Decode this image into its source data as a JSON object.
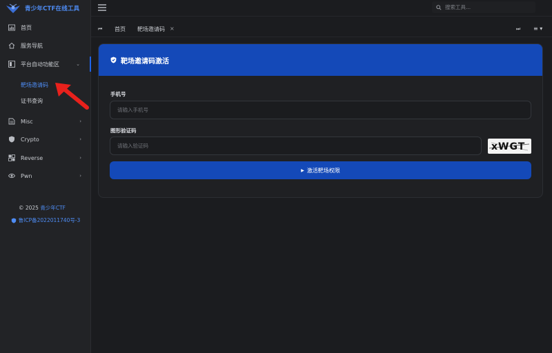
{
  "app": {
    "logo_text": "青少年CTF在线工具",
    "copyright_prefix": "© 2025",
    "copyright_brand": "青少年CTF",
    "icp": "鲁ICP备2022011740号-3"
  },
  "header": {
    "search_placeholder": "搜索工具..."
  },
  "sidebar": {
    "items": [
      {
        "label": "首页",
        "icon": "chart-icon"
      },
      {
        "label": "服务导航",
        "icon": "home-icon"
      },
      {
        "label": "平台自动功能区",
        "icon": "grid-icon",
        "expanded": true
      },
      {
        "label": "Misc",
        "icon": "file-icon"
      },
      {
        "label": "Crypto",
        "icon": "shield-icon"
      },
      {
        "label": "Reverse",
        "icon": "puzzle-icon"
      },
      {
        "label": "Pwn",
        "icon": "eye-icon"
      }
    ],
    "subitems": [
      {
        "label": "靶场邀请码",
        "active": true
      },
      {
        "label": "证书查询",
        "active": false
      }
    ]
  },
  "tabs": [
    {
      "label": "首页"
    },
    {
      "label": "靶场邀请码",
      "closable": true
    }
  ],
  "card": {
    "title": "靶场邀请码激活",
    "phone_label": "手机号",
    "phone_placeholder": "请输入手机号",
    "captcha_label": "图形验证码",
    "captcha_placeholder": "请输入验证码",
    "captcha_text": "xWGT",
    "submit_label": "激活靶场权限"
  },
  "colors": {
    "accent": "#1449b8",
    "link": "#4e8cf4",
    "annotation_arrow": "#e8211c"
  }
}
